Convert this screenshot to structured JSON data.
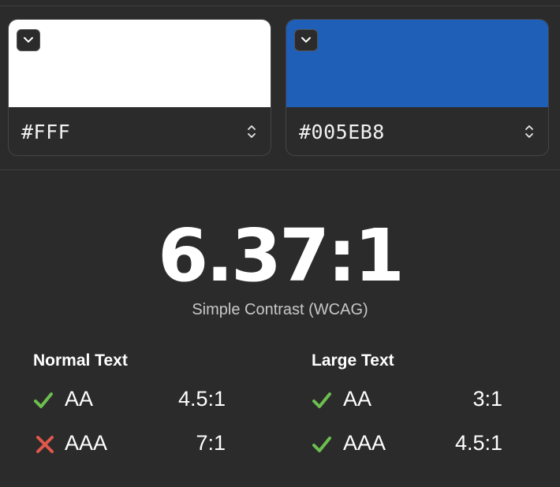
{
  "colors": {
    "foreground": {
      "hex": "#FFF",
      "swatch": "#ffffff"
    },
    "background": {
      "hex": "#005EB8",
      "swatch": "#1f5fb8"
    },
    "pass": "#6cbf4f",
    "fail": "#e0584a"
  },
  "result": {
    "ratio": "6.37:1",
    "label": "Simple Contrast (WCAG)"
  },
  "normal_text": {
    "title": "Normal Text",
    "rows": [
      {
        "level": "AA",
        "ratio": "4.5:1",
        "status": "pass"
      },
      {
        "level": "AAA",
        "ratio": "7:1",
        "status": "fail"
      }
    ]
  },
  "large_text": {
    "title": "Large Text",
    "rows": [
      {
        "level": "AA",
        "ratio": "3:1",
        "status": "pass"
      },
      {
        "level": "AAA",
        "ratio": "4.5:1",
        "status": "pass"
      }
    ]
  },
  "icons": {
    "picker": "chevron-down-icon",
    "stepper": "up-down-chevron-icon",
    "pass": "checkmark-icon",
    "fail": "cross-icon"
  }
}
